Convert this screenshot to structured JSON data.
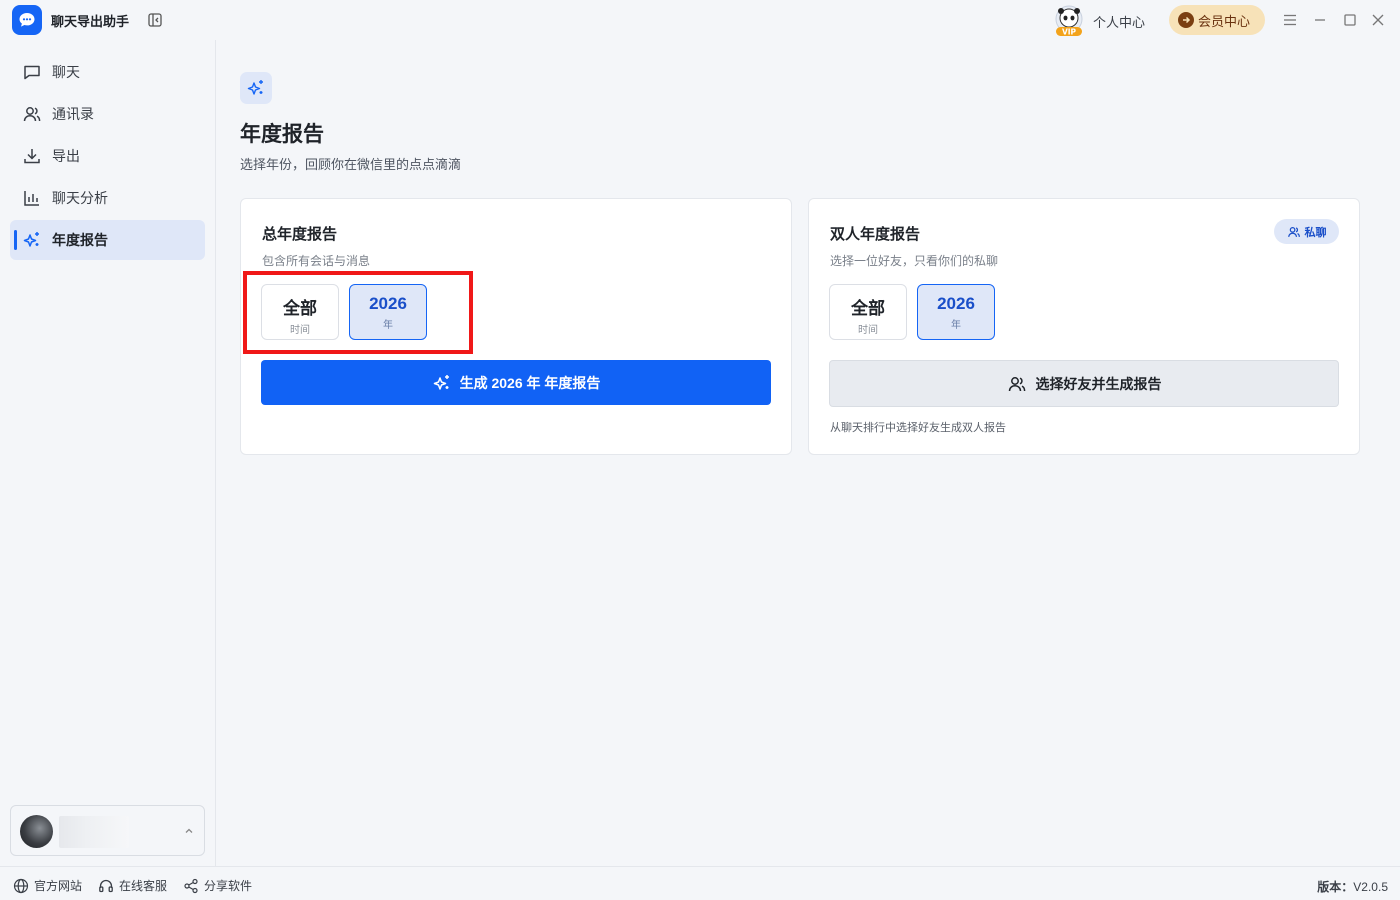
{
  "app": {
    "title": "聊天导出助手"
  },
  "header": {
    "personal_center": "个人中心",
    "member_center": "会员中心",
    "vip_label": "VIP"
  },
  "sidebar": {
    "items": [
      {
        "label": "聊天",
        "icon": "chat-bubble-icon"
      },
      {
        "label": "通讯录",
        "icon": "contacts-icon"
      },
      {
        "label": "导出",
        "icon": "download-icon"
      },
      {
        "label": "聊天分析",
        "icon": "bar-chart-icon"
      },
      {
        "label": "年度报告",
        "icon": "sparkle-icon",
        "active": true
      }
    ]
  },
  "page": {
    "title": "年度报告",
    "subtitle": "选择年份，回顾你在微信里的点点滴滴"
  },
  "cards": {
    "total": {
      "title": "总年度报告",
      "desc": "包含所有会话与消息",
      "options": [
        {
          "main": "全部",
          "sub": "时间",
          "selected": false
        },
        {
          "main": "2026",
          "sub": "年",
          "selected": true
        }
      ],
      "button": "生成 2026 年 年度报告"
    },
    "dual": {
      "title": "双人年度报告",
      "badge": "私聊",
      "desc": "选择一位好友，只看你们的私聊",
      "options": [
        {
          "main": "全部",
          "sub": "时间",
          "selected": false
        },
        {
          "main": "2026",
          "sub": "年",
          "selected": true
        }
      ],
      "button": "选择好友并生成报告",
      "note": "从聊天排行中选择好友生成双人报告"
    }
  },
  "footer": {
    "links": [
      "官方网站",
      "在线客服",
      "分享软件"
    ],
    "version_label": "版本：",
    "version": "V2.0.5"
  },
  "colors": {
    "accent": "#1565f5",
    "active_bg": "#dfe7f8",
    "highlight": "#f01818"
  }
}
